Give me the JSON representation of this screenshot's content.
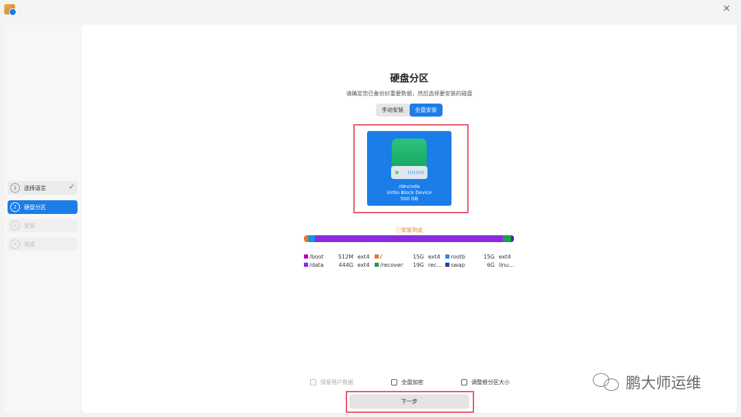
{
  "window": {
    "close_glyph": "✕"
  },
  "sidebar": {
    "steps": [
      {
        "num": "1",
        "label": "选择语言",
        "state": "done",
        "check": "✓"
      },
      {
        "num": "2",
        "label": "硬盘分区",
        "state": "active"
      },
      {
        "num": "3",
        "label": "安装",
        "state": "disabled"
      },
      {
        "num": "4",
        "label": "完成",
        "state": "disabled"
      }
    ]
  },
  "main": {
    "title": "硬盘分区",
    "subtitle": "请确定您已备份好重要数据，然后选择要安装的磁盘",
    "tabs": [
      {
        "label": "手动安装",
        "selected": false
      },
      {
        "label": "全盘安装",
        "selected": true
      }
    ],
    "disk": {
      "path": "/dev/vda",
      "model": "Virtio Block Device",
      "size": "500 GB",
      "icon": "hard-drive-icon"
    },
    "install_target_label": "ⓘ安装到此",
    "partition_bar": [
      {
        "name": "/boot",
        "color": "#e87722",
        "share": 2
      },
      {
        "name": "rootb",
        "color": "#1e90e0",
        "share": 3
      },
      {
        "name": "/data",
        "color": "#8a2be2",
        "share": 88
      },
      {
        "name": "/recovery",
        "color": "#1f9d55",
        "share": 4
      },
      {
        "name": "swap",
        "color": "#2a3aa8",
        "share": 1.2
      }
    ],
    "legend": [
      [
        {
          "name": "/boot",
          "size": "512M",
          "fs": "ext4",
          "color": "#b800b8"
        },
        {
          "name": "/",
          "size": "15G",
          "fs": "ext4",
          "color": "#e87722"
        },
        {
          "name": "rootb",
          "size": "15G",
          "fs": "ext4",
          "color": "#1e90e0"
        }
      ],
      [
        {
          "name": "/data",
          "size": "444G",
          "fs": "ext4",
          "color": "#8a2be2"
        },
        {
          "name": "/recovery",
          "size": "19G",
          "fs": "rec…",
          "color": "#1f9d55"
        },
        {
          "name": "swap",
          "size": "6G",
          "fs": "linu…",
          "color": "#2a3aa8"
        }
      ]
    ],
    "options": [
      {
        "label": "保留用户数据",
        "disabled": true
      },
      {
        "label": "全盘加密",
        "disabled": false
      },
      {
        "label": "调整根分区大小",
        "disabled": false
      }
    ],
    "next_button": "下一步"
  },
  "watermark": {
    "text": "鹏大师运维"
  },
  "colors": {
    "accent": "#1b7de8",
    "highlight": "#e55a6a",
    "warning": "#f07a16"
  }
}
